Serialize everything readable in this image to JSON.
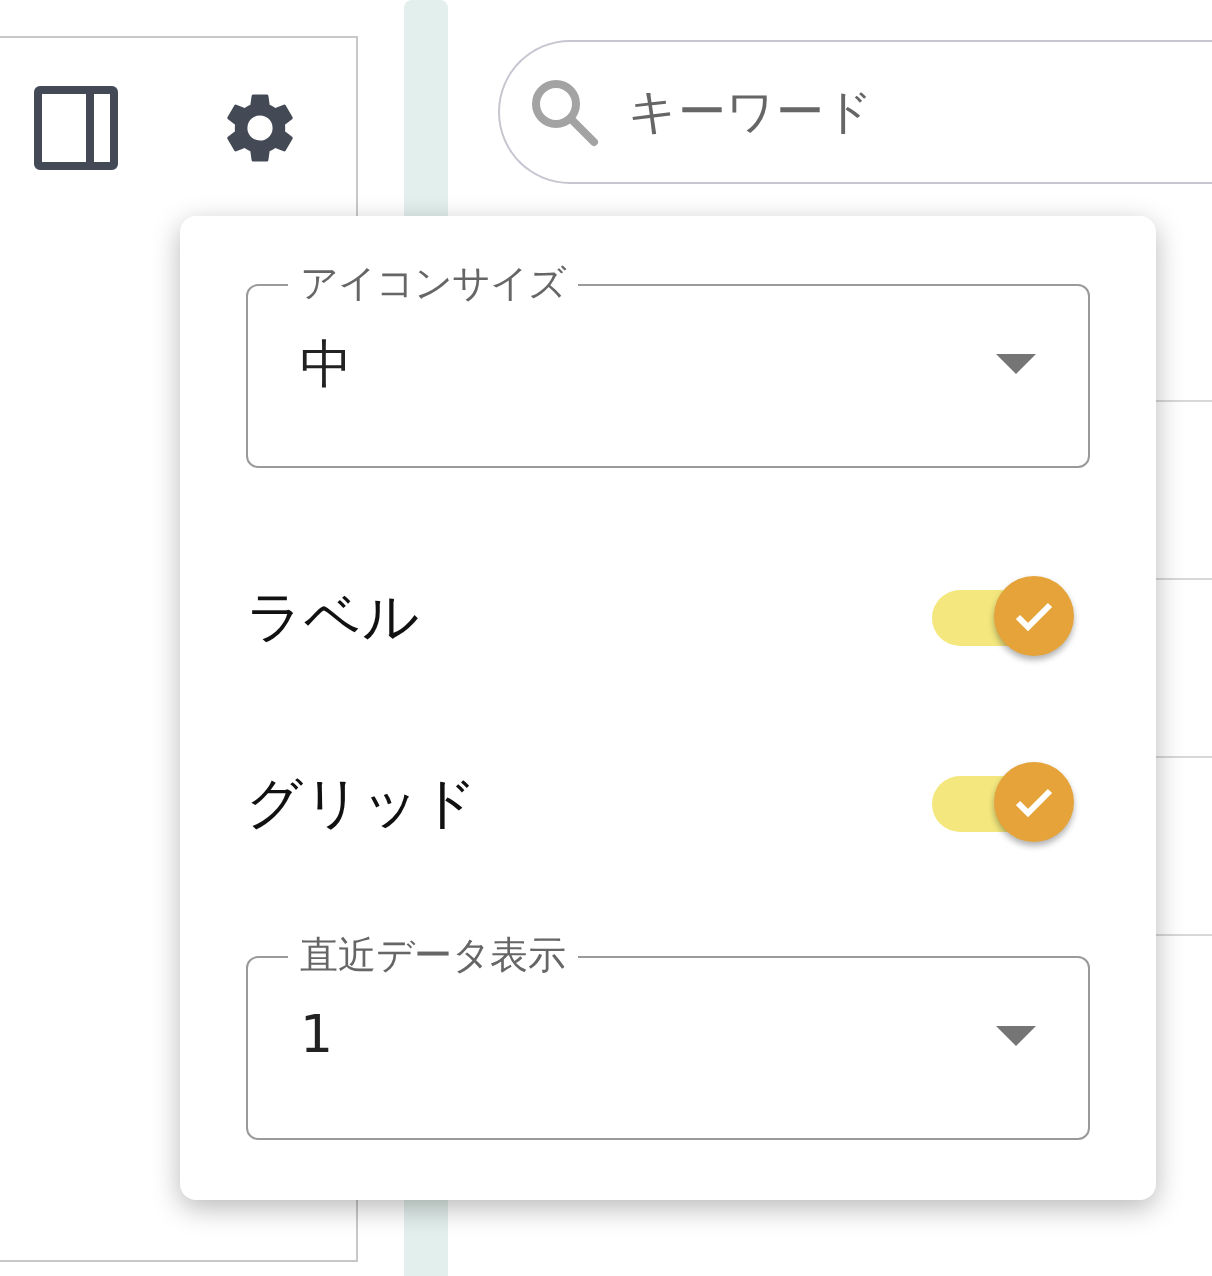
{
  "search": {
    "placeholder": "キーワード"
  },
  "settings_popup": {
    "fields": [
      {
        "kind": "select",
        "label": "アイコンサイズ",
        "value": "中"
      },
      {
        "kind": "switch",
        "label": "ラベル",
        "on": true
      },
      {
        "kind": "switch",
        "label": "グリッド",
        "on": true
      },
      {
        "kind": "select",
        "label": "直近データ表示",
        "value": "1"
      }
    ]
  }
}
